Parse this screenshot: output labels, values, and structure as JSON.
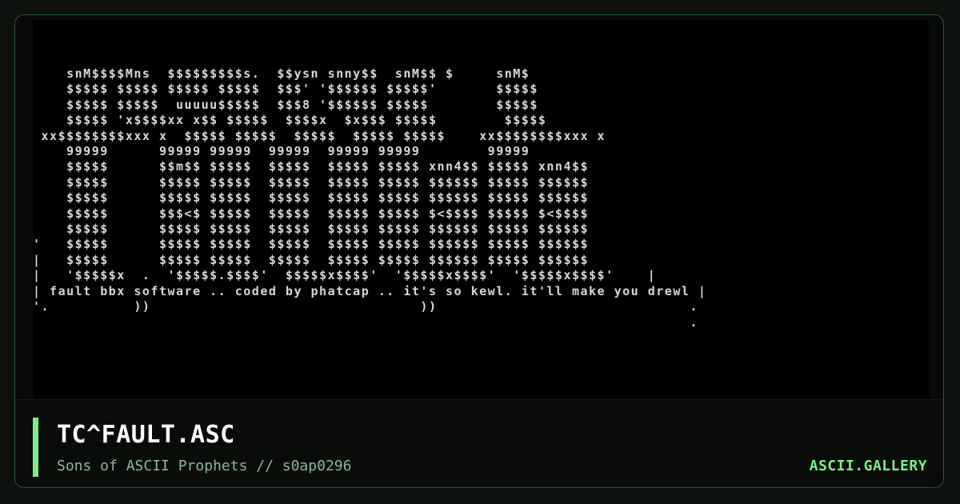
{
  "artwork": {
    "ascii_lines": [
      "    snM$$$$Mns  $$$$$$$$$s.  $$ysn snny$$  snM$$ $     snM$",
      "    $$$$$ $$$$$ $$$$$ $$$$$  $$$' '$$$$$$ $$$$$'       $$$$$",
      "    $$$$$ $$$$$  uuuuu$$$$$  $$$8 '$$$$$$ $$$$$        $$$$$",
      "    $$$$$ 'x$$$$xx x$$ $$$$$  $$$$x  $x$$$ $$$$$        $$$$$",
      " xx$$$$$$$$xxx x  $$$$$ $$$$$  $$$$$  $$$$$ $$$$$    xx$$$$$$$$xxx x",
      "    99999      99999 99999  99999  99999 99999        99999",
      "    $$$$$      $$m$$ $$$$$  $$$$$  $$$$$ $$$$$ xnn4$$ $$$$$ xnn4$$",
      "    $$$$$      $$$$$ $$$$$  $$$$$  $$$$$ $$$$$ $$$$$$ $$$$$ $$$$$$",
      "    $$$$$      $$$$$ $$$$$  $$$$$  $$$$$ $$$$$ $$$$$$ $$$$$ $$$$$$",
      "    $$$$$      $$$<$ $$$$$  $$$$$  $$$$$ $$$$$ $<$$$$ $$$$$ $<$$$$",
      "    $$$$$      $$$$$ $$$$$  $$$$$  $$$$$ $$$$$ $$$$$$ $$$$$ $$$$$$",
      "'   $$$$$      $$$$$ $$$$$  $$$$$  $$$$$ $$$$$ $$$$$$ $$$$$ $$$$$$",
      "|   $$$$$      $$$$$ $$$$$  $$$$$  $$$$$ $$$$$ $$$$$$ $$$$$ $$$$$$",
      "|   '$$$$$x  .  '$$$$$.$$$$'  $$$$$x$$$$'  '$$$$$x$$$$'  '$$$$$x$$$$'    |",
      "| fault bbx software .. coded by phatcap .. it's so kewl. it'll make you drewl |",
      "'.          ))                                ))                              .",
      "                                                                              ."
    ]
  },
  "footer": {
    "title": "TC^FAULT.ASC",
    "subtitle": "Sons of ASCII Prophets // s0ap0296",
    "brand": "ASCII.GALLERY"
  },
  "colors": {
    "accent": "#7bf08a",
    "art_text": "#d8d8d8",
    "background": "#0d120f"
  }
}
